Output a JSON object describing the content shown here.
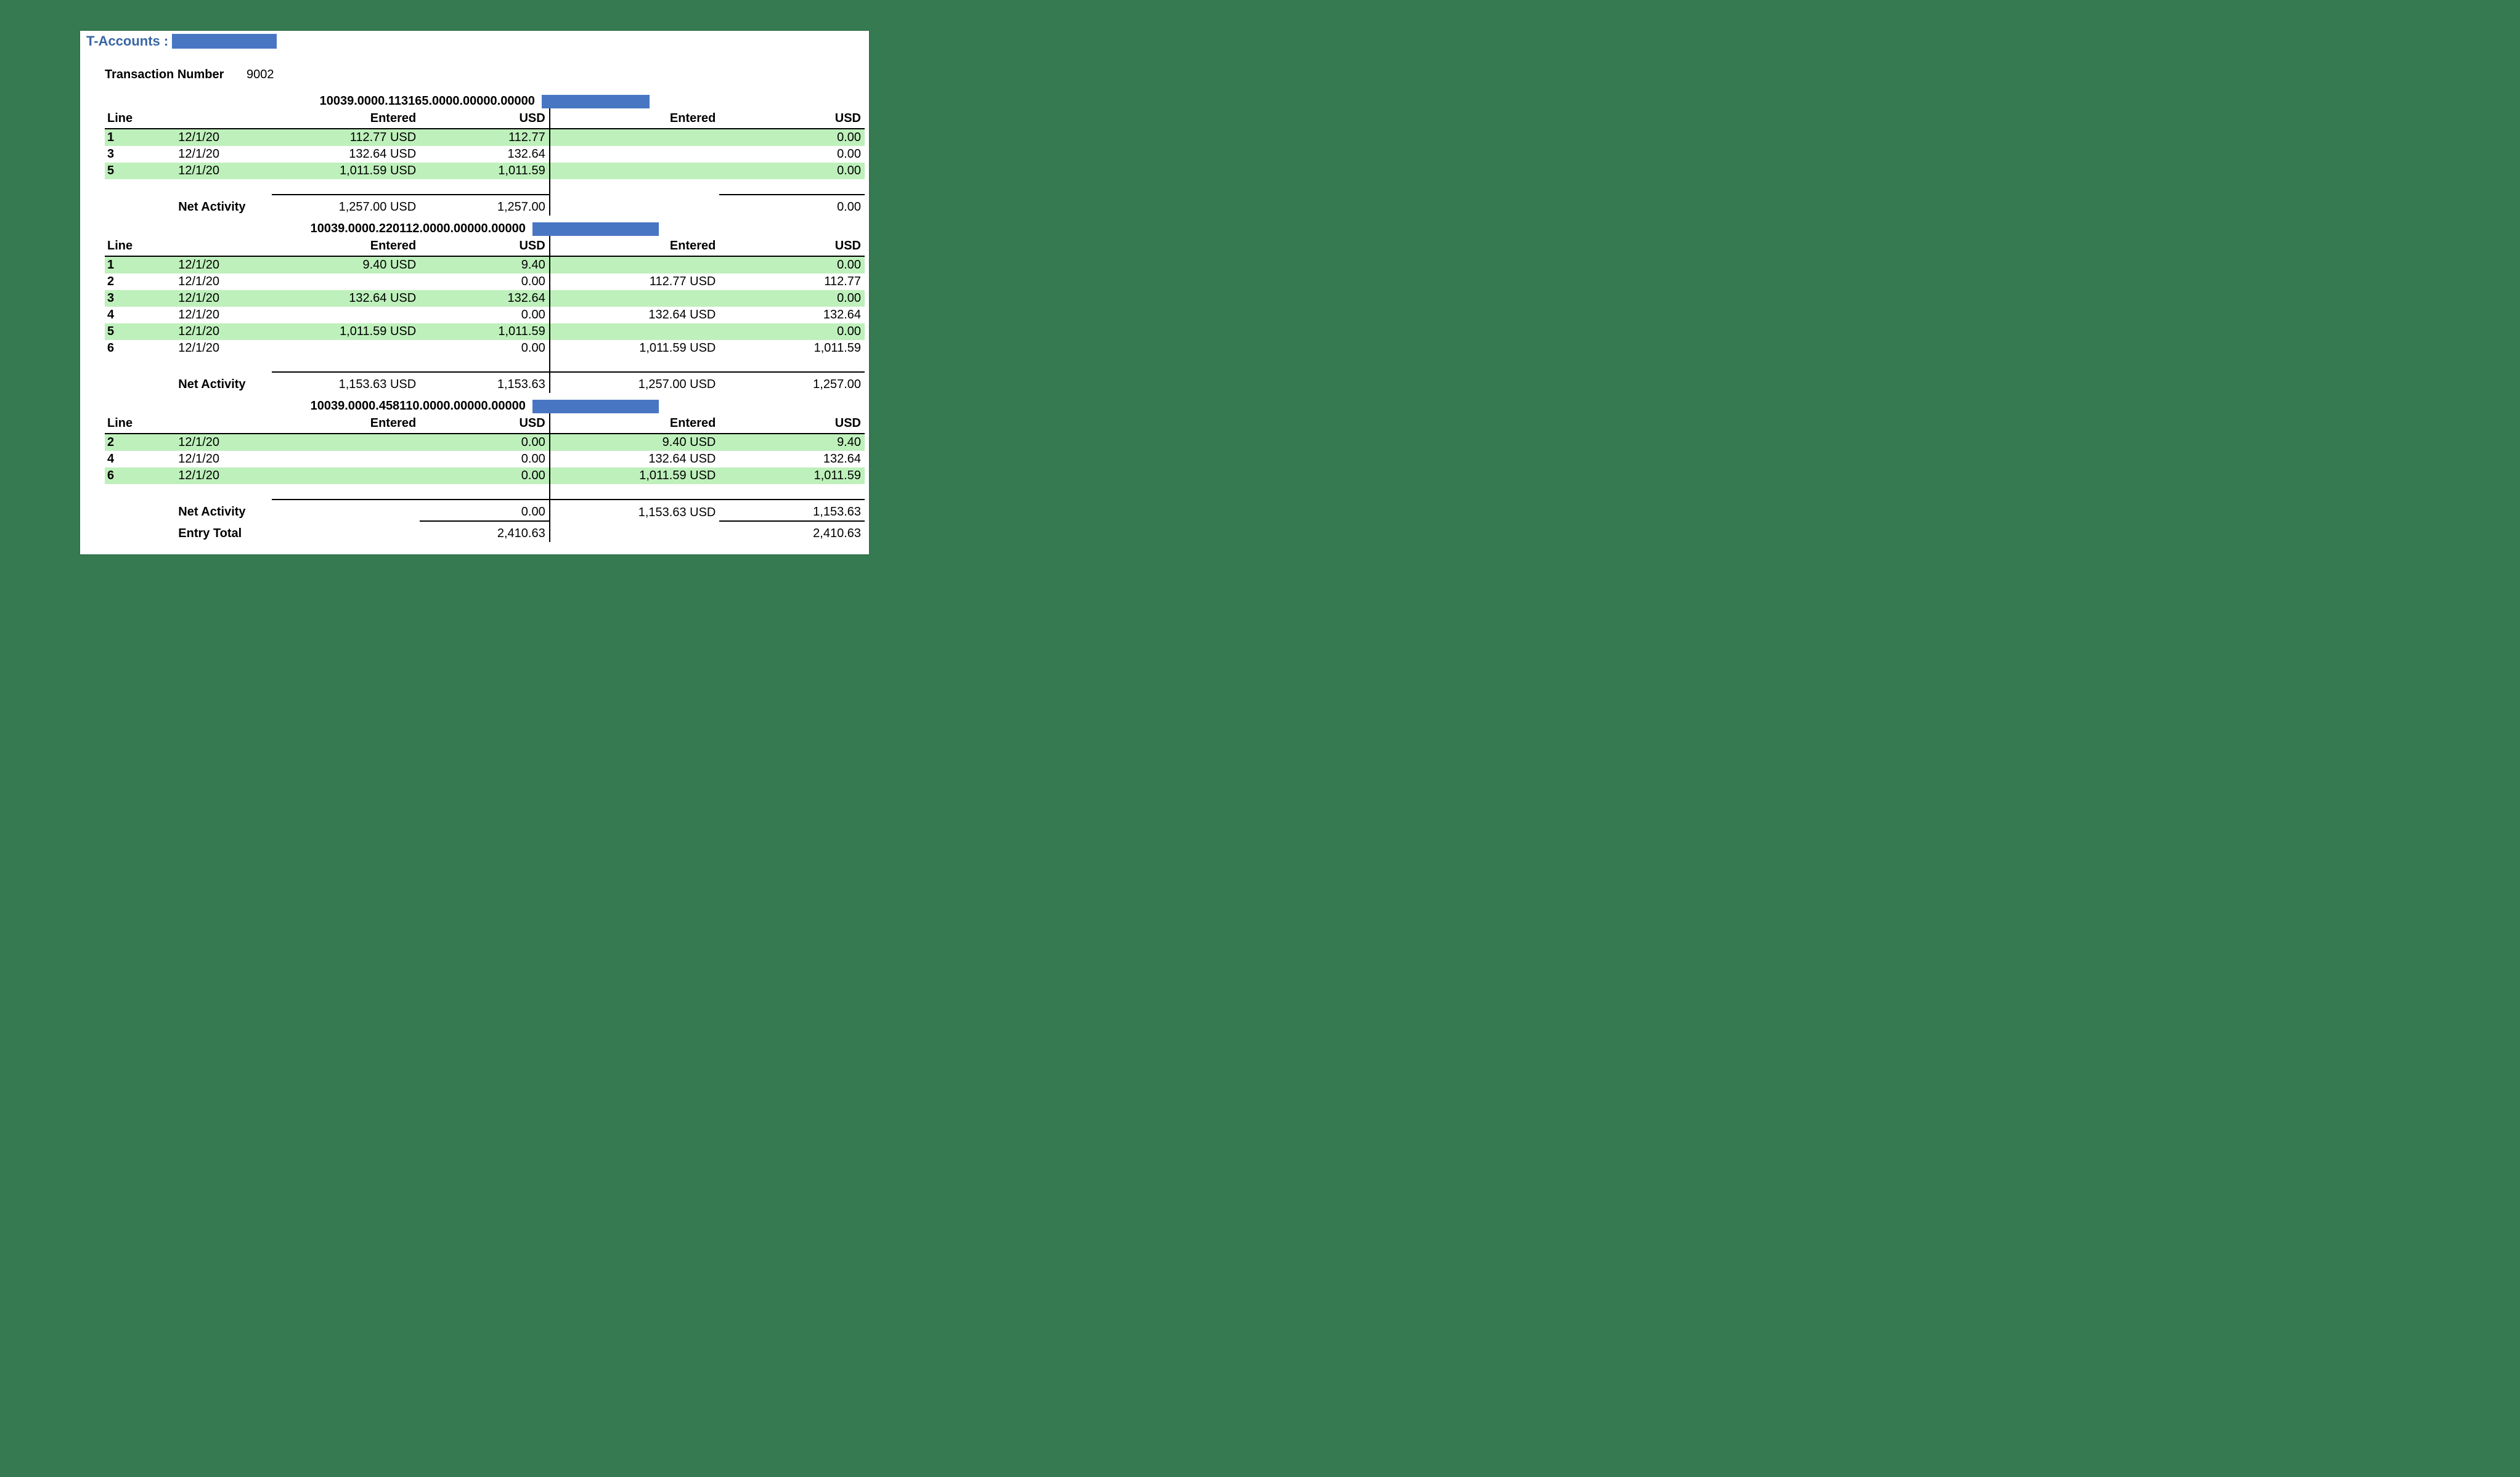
{
  "title": "T-Accounts :",
  "transaction": {
    "label": "Transaction Number",
    "value": "9002"
  },
  "headers": {
    "line": "Line",
    "entered": "Entered",
    "usd": "USD",
    "entered2": "Entered",
    "usd2": "USD"
  },
  "netActivityLabel": "Net Activity",
  "entryTotalLabel": "Entry Total",
  "accounts": [
    {
      "code": "10039.0000.113165.0000.00000.00000",
      "redactClass": "redact-acct",
      "rows": [
        {
          "line": "1",
          "date": "12/1/20",
          "ent": "112.77 USD",
          "usd": "112.77",
          "ent2": "",
          "usd2": "0.00",
          "g": true
        },
        {
          "line": "3",
          "date": "12/1/20",
          "ent": "132.64 USD",
          "usd": "132.64",
          "ent2": "",
          "usd2": "0.00",
          "g": false
        },
        {
          "line": "5",
          "date": "12/1/20",
          "ent": "1,011.59 USD",
          "usd": "1,011.59",
          "ent2": "",
          "usd2": "0.00",
          "g": true
        }
      ],
      "net": {
        "ent": "1,257.00 USD",
        "usd": "1,257.00",
        "ent2": "",
        "usd2": "0.00",
        "ent2Rule": false
      }
    },
    {
      "code": "10039.0000.220112.0000.00000.00000",
      "redactClass": "redact-acct2",
      "rows": [
        {
          "line": "1",
          "date": "12/1/20",
          "ent": "9.40 USD",
          "usd": "9.40",
          "ent2": "",
          "usd2": "0.00",
          "g": true
        },
        {
          "line": "2",
          "date": "12/1/20",
          "ent": "",
          "usd": "0.00",
          "ent2": "112.77 USD",
          "usd2": "112.77",
          "g": false
        },
        {
          "line": "3",
          "date": "12/1/20",
          "ent": "132.64 USD",
          "usd": "132.64",
          "ent2": "",
          "usd2": "0.00",
          "g": true
        },
        {
          "line": "4",
          "date": "12/1/20",
          "ent": "",
          "usd": "0.00",
          "ent2": "132.64 USD",
          "usd2": "132.64",
          "g": false
        },
        {
          "line": "5",
          "date": "12/1/20",
          "ent": "1,011.59 USD",
          "usd": "1,011.59",
          "ent2": "",
          "usd2": "0.00",
          "g": true
        },
        {
          "line": "6",
          "date": "12/1/20",
          "ent": "",
          "usd": "0.00",
          "ent2": "1,011.59 USD",
          "usd2": "1,011.59",
          "g": false
        }
      ],
      "net": {
        "ent": "1,153.63 USD",
        "usd": "1,153.63",
        "ent2": "1,257.00 USD",
        "usd2": "1,257.00",
        "ent2Rule": true
      }
    },
    {
      "code": "10039.0000.458110.0000.00000.00000",
      "redactClass": "redact-acct2",
      "rows": [
        {
          "line": "2",
          "date": "12/1/20",
          "ent": "",
          "usd": "0.00",
          "ent2": "9.40 USD",
          "usd2": "9.40",
          "g": true
        },
        {
          "line": "4",
          "date": "12/1/20",
          "ent": "",
          "usd": "0.00",
          "ent2": "132.64 USD",
          "usd2": "132.64",
          "g": false
        },
        {
          "line": "6",
          "date": "12/1/20",
          "ent": "",
          "usd": "0.00",
          "ent2": "1,011.59 USD",
          "usd2": "1,011.59",
          "g": true
        }
      ],
      "net": {
        "ent": "",
        "usd": "0.00",
        "ent2": "1,153.63 USD",
        "usd2": "1,153.63",
        "ent2Rule": true
      }
    }
  ],
  "entryTotal": {
    "usd": "2,410.63",
    "usd2": "2,410.63"
  }
}
